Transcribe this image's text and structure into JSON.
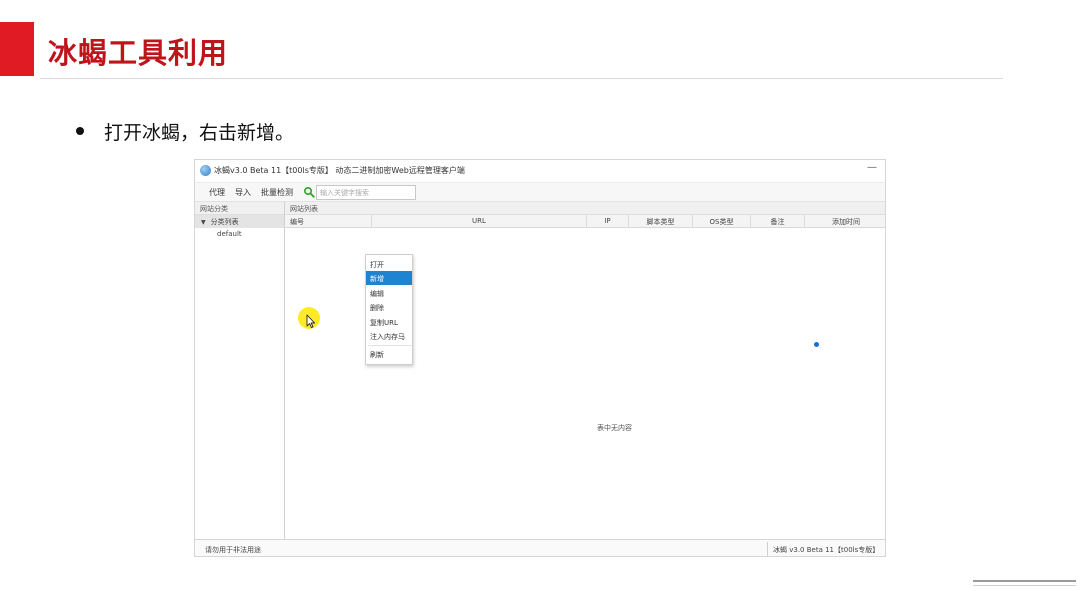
{
  "slide": {
    "title": "冰蝎工具利用",
    "bullet": "打开冰蝎，右击新增。"
  },
  "colors": {
    "accent": "#e01b24",
    "title": "#c0141d",
    "menu_highlight": "#1e84d2"
  },
  "window": {
    "icon": "scorpion-app-icon",
    "title": "冰蝎v3.0 Beta 11【t00ls专版】 动态二进制加密Web远程管理客户端",
    "minimize": "—"
  },
  "toolbar": {
    "proxy": "代理",
    "import": "导入",
    "batch_check": "批量检测",
    "search_icon": "search-icon",
    "search_placeholder": "输入关键字搜索"
  },
  "sidebar": {
    "header": "网站分类",
    "tree_root": "分类列表",
    "tree_children": [
      "default"
    ]
  },
  "main": {
    "header": "网站列表",
    "columns": [
      "编号",
      "URL",
      "IP",
      "脚本类型",
      "OS类型",
      "备注",
      "添加时间"
    ],
    "empty_text": "表中无内容"
  },
  "context_menu": {
    "items": [
      "打开",
      "新增",
      "编辑",
      "删除",
      "复制URL",
      "注入内存马",
      "刷新"
    ],
    "selected": "新增"
  },
  "statusbar": {
    "left": "请勿用于非法用途",
    "right": "冰蝎 v3.0 Beta 11【t00ls专版】"
  }
}
